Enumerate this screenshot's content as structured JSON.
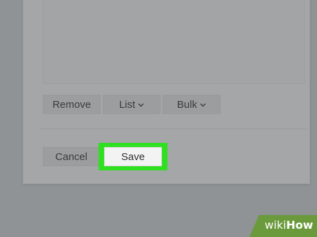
{
  "toolbar": {
    "remove_label": "Remove",
    "list_label": "List",
    "bulk_label": "Bulk"
  },
  "footer": {
    "cancel_label": "Cancel",
    "save_label": "Save"
  },
  "watermark": {
    "prefix": "wiki",
    "suffix": "How"
  },
  "colors": {
    "highlight": "#2ee01f",
    "brand_green": "#6a9a3b"
  },
  "icons": {
    "dropdown": "chevron-down-icon"
  }
}
